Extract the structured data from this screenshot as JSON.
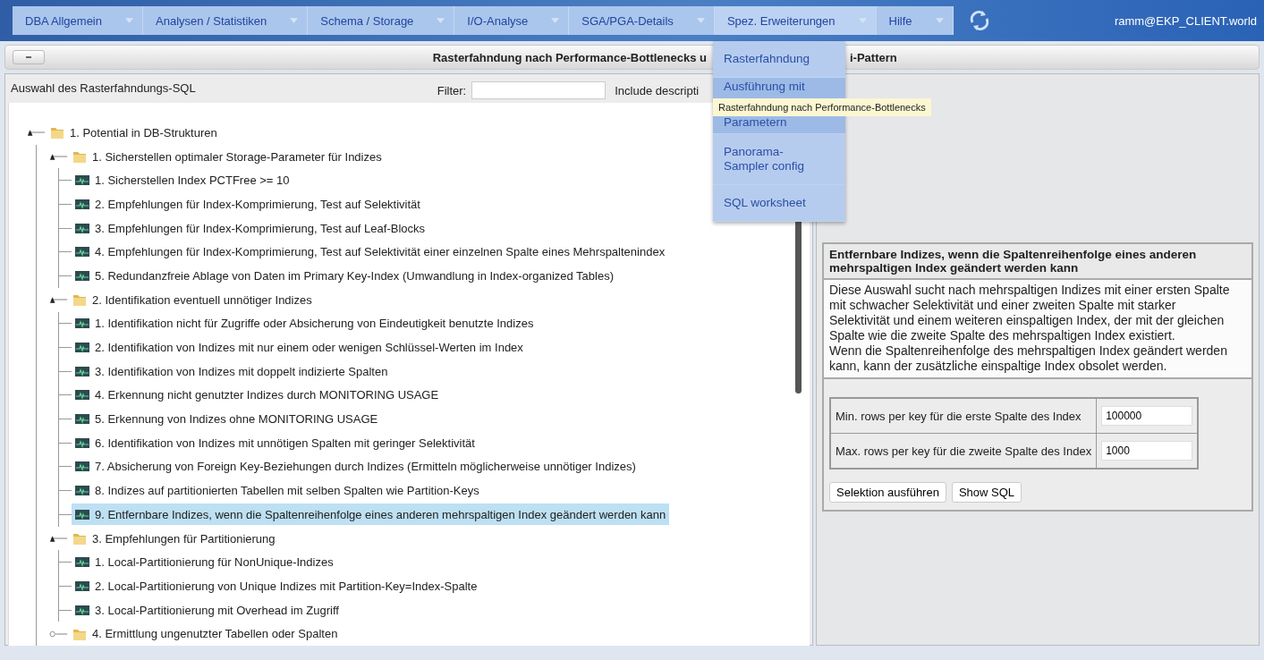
{
  "nav": {
    "items": [
      {
        "label": "DBA Allgemein",
        "open": false
      },
      {
        "label": "Analysen / Statistiken",
        "open": false
      },
      {
        "label": "Schema / Storage",
        "open": false
      },
      {
        "label": "I/O-Analyse",
        "open": false
      },
      {
        "label": "SGA/PGA-Details",
        "open": false
      },
      {
        "label": "Spez. Erweiterungen",
        "open": true
      },
      {
        "label": "Hilfe",
        "open": false
      }
    ],
    "user": "ramm@EKP_CLIENT.world"
  },
  "menu": {
    "items": [
      {
        "lines": [
          "Rasterfahndung"
        ],
        "selected": false
      },
      {
        "lines": [
          "Ausführung mit",
          "Parametern"
        ],
        "selected": true
      },
      {
        "lines": [
          "Panorama-",
          "Sampler config"
        ],
        "selected": false
      },
      {
        "lines": [
          "SQL worksheet"
        ],
        "selected": false
      }
    ]
  },
  "tooltip": "Rasterfahndung nach Performance-Bottlenecks",
  "panel": {
    "title_left": "Rasterfahndung nach Performance-Bottlenecks u",
    "title_right": "i-Pattern"
  },
  "selection": {
    "title": "Auswahl des Rasterfahndungs-SQL",
    "filter_label": "Filter:",
    "include_label": "Include descripti",
    "tree": [
      {
        "kind": "folder",
        "label": "1. Potential in DB-Strukturen",
        "expanded": true,
        "children": [
          {
            "kind": "folder",
            "label": "1. Sicherstellen optimaler Storage-Parameter für Indizes",
            "expanded": true,
            "children": [
              {
                "kind": "leaf",
                "label": "1. Sicherstellen Index PCTFree >= 10",
                "selected": false
              },
              {
                "kind": "leaf",
                "label": "2. Empfehlungen für Index-Komprimierung, Test auf Selektivität",
                "selected": false
              },
              {
                "kind": "leaf",
                "label": "3. Empfehlungen für Index-Komprimierung, Test auf Leaf-Blocks",
                "selected": false
              },
              {
                "kind": "leaf",
                "label": "4. Empfehlungen für Index-Komprimierung, Test auf Selektivität einer einzelnen Spalte eines Mehrspaltenindex",
                "selected": false
              },
              {
                "kind": "leaf",
                "label": "5. Redundanzfreie Ablage von Daten im Primary Key-Index (Umwandlung in Index-organized Tables)",
                "selected": false
              }
            ]
          },
          {
            "kind": "folder",
            "label": "2. Identifikation eventuell unnötiger Indizes",
            "expanded": true,
            "children": [
              {
                "kind": "leaf",
                "label": "1. Identifikation nicht für Zugriffe oder Absicherung von Eindeutigkeit benutzte Indizes",
                "selected": false
              },
              {
                "kind": "leaf",
                "label": "2. Identifikation von Indizes mit nur einem oder wenigen Schlüssel-Werten im Index",
                "selected": false
              },
              {
                "kind": "leaf",
                "label": "3. Identifikation von Indizes mit doppelt indizierte Spalten",
                "selected": false
              },
              {
                "kind": "leaf",
                "label": "4. Erkennung nicht genutzter Indizes durch MONITORING USAGE",
                "selected": false
              },
              {
                "kind": "leaf",
                "label": "5. Erkennung von Indizes ohne MONITORING USAGE",
                "selected": false
              },
              {
                "kind": "leaf",
                "label": "6. Identifikation von Indizes mit unnötigen Spalten mit geringer Selektivität",
                "selected": false
              },
              {
                "kind": "leaf",
                "label": "7. Absicherung von Foreign Key-Beziehungen durch Indizes (Ermitteln möglicherweise unnötiger Indizes)",
                "selected": false
              },
              {
                "kind": "leaf",
                "label": "8. Indizes auf partitionierten Tabellen mit selben Spalten wie Partition-Keys",
                "selected": false
              },
              {
                "kind": "leaf",
                "label": "9. Entfernbare Indizes, wenn die Spaltenreihenfolge eines anderen mehrspaltigen Index geändert werden kann",
                "selected": true
              }
            ]
          },
          {
            "kind": "folder",
            "label": "3. Empfehlungen für Partitionierung",
            "expanded": true,
            "children": [
              {
                "kind": "leaf",
                "label": "1. Local-Partitionierung für NonUnique-Indizes",
                "selected": false
              },
              {
                "kind": "leaf",
                "label": "2. Local-Partitionierung von Unique Indizes mit Partition-Key=Index-Spalte",
                "selected": false
              },
              {
                "kind": "leaf",
                "label": "3. Local-Partitionierung mit Overhead im Zugriff",
                "selected": false
              }
            ]
          },
          {
            "kind": "folder",
            "label": "4. Ermittlung ungenutzter Tabellen oder Spalten",
            "expanded": false
          }
        ]
      }
    ]
  },
  "detail": {
    "title": "Entfernbare Indizes, wenn die Spaltenreihenfolge eines anderen mehrspaltigen Index geändert werden kann",
    "description": "Diese Auswahl sucht nach mehrspaltigen Indizes mit einer ersten Spalte mit schwacher Selektivität und einer zweiten Spalte mit starker Selektivität und einem weiteren einspaltigen Index, der mit der gleichen Spalte wie die zweite Spalte des mehrspaltigen Index existiert.\nWenn die Spaltenreihenfolge des mehrspaltigen Index geändert werden kann, kann der zusätzliche einspaltige Index obsolet werden.",
    "params": [
      {
        "label": "Min. rows per key für die erste Spalte des Index",
        "value": "100000"
      },
      {
        "label": "Max. rows per key für die zweite Spalte des Index",
        "value": "1000"
      }
    ],
    "buttons": [
      "Selektion ausführen",
      "Show SQL"
    ]
  }
}
